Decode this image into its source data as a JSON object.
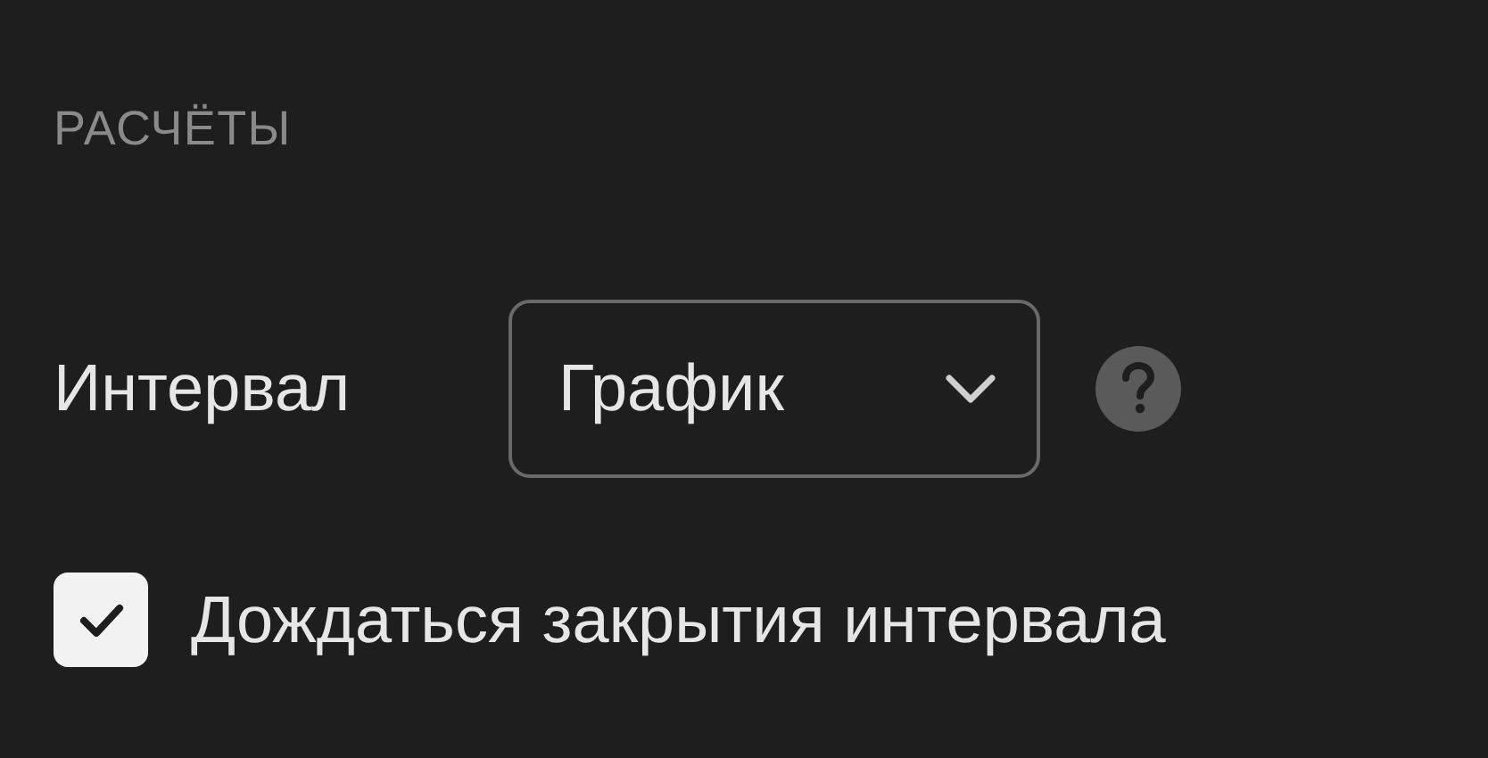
{
  "section_title": "РАСЧЁТЫ",
  "interval": {
    "label": "Интервал",
    "select": {
      "value": "График"
    }
  },
  "checkbox": {
    "label": "Дождаться закрытия интервала",
    "checked": true
  }
}
